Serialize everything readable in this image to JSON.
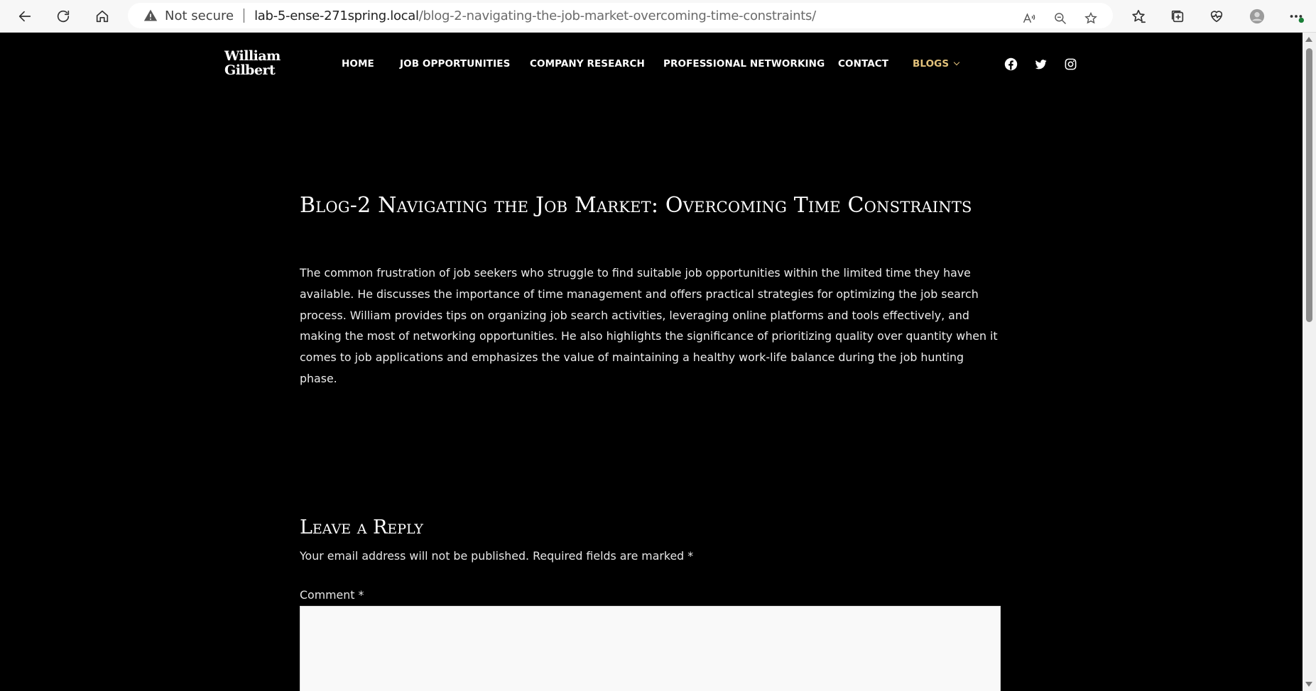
{
  "browser": {
    "security_label": "Not secure",
    "url_host": "lab-5-ense-271spring.local",
    "url_path": "/blog-2-navigating-the-job-market-overcoming-time-constraints/"
  },
  "site": {
    "logo_line1": "William",
    "logo_line2": "Gilbert",
    "nav": {
      "home": "HOME",
      "jobs": "JOB OPPORTUNITIES",
      "research": "COMPANY RESEARCH",
      "networking": "PROFESSIONAL NETWORKING",
      "contact": "CONTACT",
      "blogs": "BLOGS"
    },
    "active_color": "#e3c27b"
  },
  "post": {
    "title": "Blog-2 Navigating the Job Market: Overcoming Time Constraints",
    "body": "The common frustration of job seekers who struggle to find suitable job opportunities within the limited time they have available. He discusses the importance of time management and offers practical strategies for optimizing the job search process. William provides tips on organizing job search activities, leveraging online platforms and tools effectively, and making the most of networking opportunities. He also highlights the significance of prioritizing quality over quantity when it comes to job applications and emphasizes the value of maintaining a healthy work-life balance during the job hunting phase."
  },
  "reply": {
    "title": "Leave a Reply",
    "notes_prefix": "Your email address will not be published.",
    "notes_required": "Required fields are marked",
    "asterisk": "*",
    "comment_label": "Comment",
    "comment_value": ""
  }
}
